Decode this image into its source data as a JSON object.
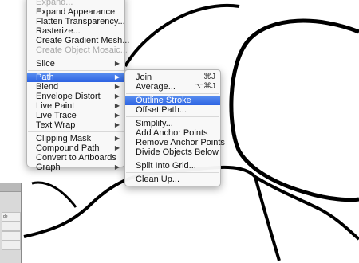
{
  "main_menu": {
    "items": [
      {
        "label": "Expand...",
        "disabled": true
      },
      {
        "label": "Expand Appearance"
      },
      {
        "label": "Flatten Transparency..."
      },
      {
        "label": "Rasterize..."
      },
      {
        "label": "Create Gradient Mesh..."
      },
      {
        "label": "Create Object Mosaic...",
        "disabled": true
      },
      {
        "label": "Slice",
        "submenu": true
      },
      {
        "label": "Path",
        "submenu": true,
        "highlighted": true
      },
      {
        "label": "Blend",
        "submenu": true
      },
      {
        "label": "Envelope Distort",
        "submenu": true
      },
      {
        "label": "Live Paint",
        "submenu": true
      },
      {
        "label": "Live Trace",
        "submenu": true
      },
      {
        "label": "Text Wrap",
        "submenu": true
      },
      {
        "label": "Clipping Mask",
        "submenu": true
      },
      {
        "label": "Compound Path",
        "submenu": true
      },
      {
        "label": "Convert to Artboards"
      },
      {
        "label": "Graph",
        "submenu": true
      }
    ]
  },
  "path_submenu": {
    "items": [
      {
        "label": "Join",
        "shortcut": "⌘J"
      },
      {
        "label": "Average...",
        "shortcut": "⌥⌘J"
      },
      {
        "label": "Outline Stroke",
        "highlighted": true
      },
      {
        "label": "Offset Path..."
      },
      {
        "label": "Simplify..."
      },
      {
        "label": "Add Anchor Points"
      },
      {
        "label": "Remove Anchor Points"
      },
      {
        "label": "Divide Objects Below"
      },
      {
        "label": "Split Into Grid..."
      },
      {
        "label": "Clean Up..."
      }
    ]
  },
  "panel": {
    "row_label": "de"
  },
  "colors": {
    "highlight": "#3a74e8",
    "stroke": "#000000"
  }
}
